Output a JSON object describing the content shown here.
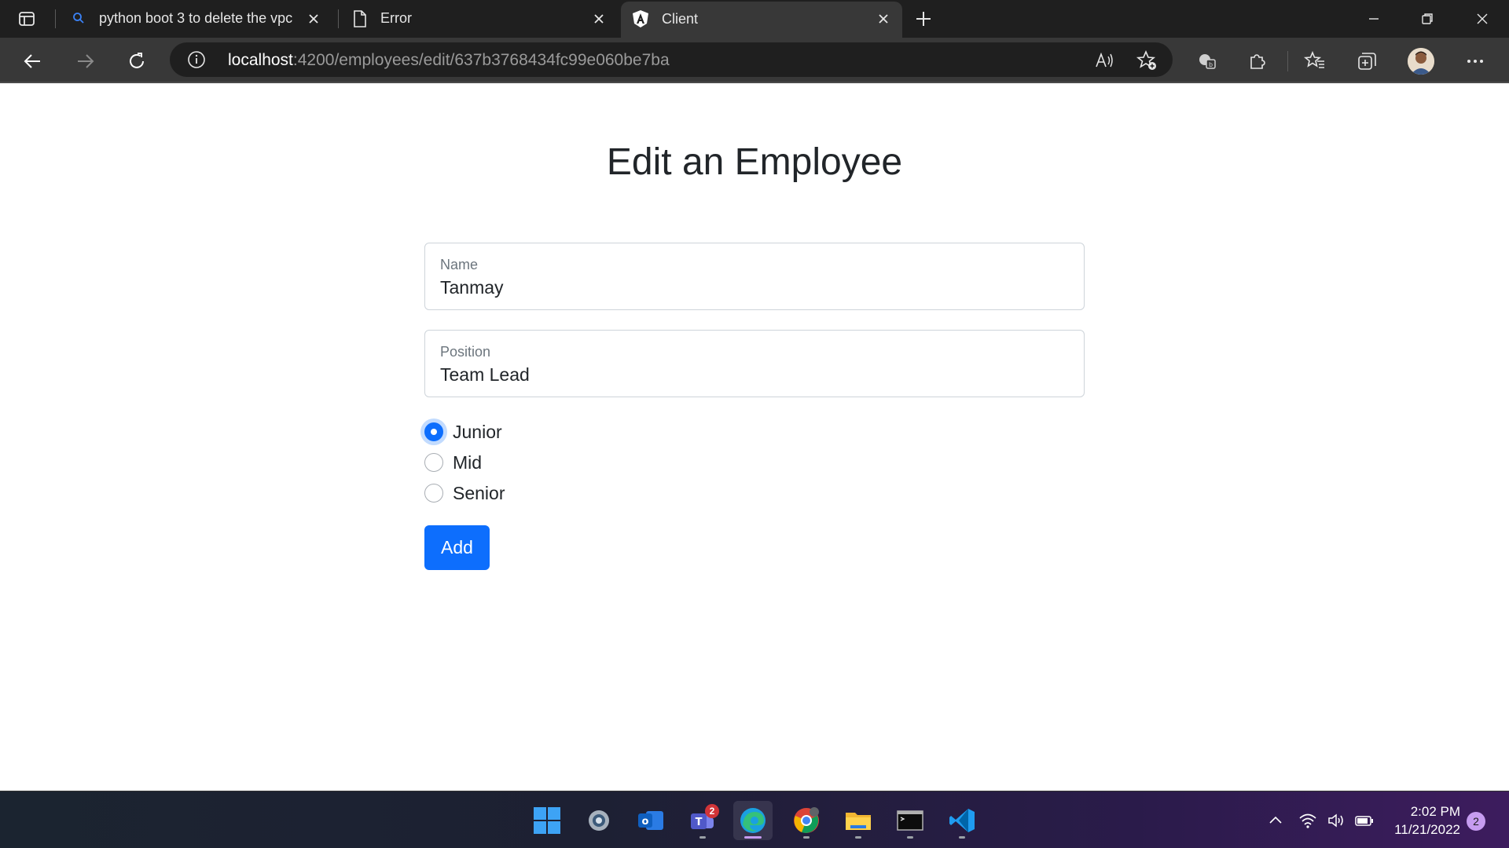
{
  "browser": {
    "tabs": [
      {
        "title": "python boot 3 to delete the vpc",
        "icon": "search-icon"
      },
      {
        "title": "Error",
        "icon": "document-icon"
      },
      {
        "title": "Client",
        "icon": "angular-icon",
        "active": true
      }
    ],
    "url_host": "localhost",
    "url_path": ":4200/employees/edit/637b3768434fc99e060be7ba"
  },
  "page": {
    "title": "Edit an Employee",
    "name_label": "Name",
    "name_value": "Tanmay",
    "position_label": "Position",
    "position_value": "Team Lead",
    "levels": [
      {
        "label": "Junior",
        "checked": true
      },
      {
        "label": "Mid",
        "checked": false
      },
      {
        "label": "Senior",
        "checked": false
      }
    ],
    "add_button_label": "Add"
  },
  "taskbar": {
    "teams_badge": "2",
    "time": "2:02 PM",
    "date": "11/21/2022",
    "notification_count": "2"
  },
  "colors": {
    "primary": "#0d6efd",
    "tabbar_bg": "#1f1f1f",
    "toolbar_bg": "#383838"
  }
}
